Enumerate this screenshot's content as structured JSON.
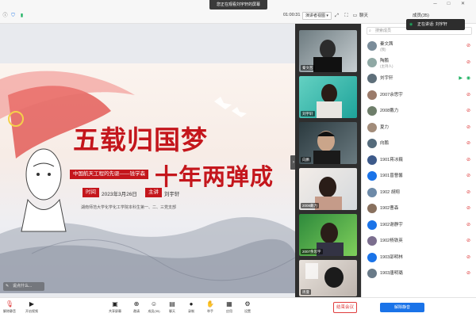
{
  "topbar": {
    "viewing_banner": "您正在观看刘宇轩的屏幕",
    "timer": "01:00:31",
    "view_mode": "演讲者视图",
    "chat_tab": "聊天",
    "members_tab": "成员(35)"
  },
  "slide": {
    "title_line1": "五载归国梦",
    "title_line2": "十年两弹成",
    "subtitle": "中国航天工程的先驱——钱学森",
    "time_label": "时间",
    "time_value": "2023年3月26日",
    "speaker_label": "主讲",
    "speaker_value": "刘宇轩",
    "school_line": "湖南师范大学化学化工学院本科生第一、二、三党支部"
  },
  "comment_placeholder": "说点什么...",
  "video_tiles": [
    {
      "name": "秦文茜"
    },
    {
      "name": "刘宇轩"
    },
    {
      "name": "向鹏"
    },
    {
      "name": "2008戴力"
    },
    {
      "name": "2007余思宇"
    },
    {
      "name": "周曼"
    }
  ],
  "side": {
    "search_placeholder": "搜索成员",
    "speaking_tip": "正在讲话: 刘宇轩",
    "members": [
      {
        "name": "秦文茜",
        "sub": "(我)"
      },
      {
        "name": "陶鹏",
        "sub": "(主持人)"
      },
      {
        "name": "刘宇轩",
        "sub": ""
      },
      {
        "name": "2007余思宇",
        "sub": ""
      },
      {
        "name": "2008戴力",
        "sub": ""
      },
      {
        "name": "夏力",
        "sub": ""
      },
      {
        "name": "向鹏",
        "sub": ""
      },
      {
        "name": "1901蒋冰巍",
        "sub": ""
      },
      {
        "name": "1901曾曹馨",
        "sub": ""
      },
      {
        "name": "1902 胡翔",
        "sub": ""
      },
      {
        "name": "1902曹森",
        "sub": ""
      },
      {
        "name": "1902谢静宇",
        "sub": ""
      },
      {
        "name": "1902杨铁英",
        "sub": ""
      },
      {
        "name": "1903邵明林",
        "sub": ""
      },
      {
        "name": "1903唐明璐",
        "sub": ""
      }
    ]
  },
  "bottombar": {
    "mute": "解除静音",
    "video": "开启视频",
    "share": "共享屏幕",
    "invite": "邀请",
    "members": "成员(35)",
    "chat": "聊天",
    "record": "录制",
    "raise": "举手",
    "apps": "应用",
    "settings": "设置",
    "end_meeting": "结束会议",
    "unmute_all": "解除静音"
  },
  "colors": {
    "accent_red": "#c4161c",
    "primary_blue": "#1a73e8"
  }
}
